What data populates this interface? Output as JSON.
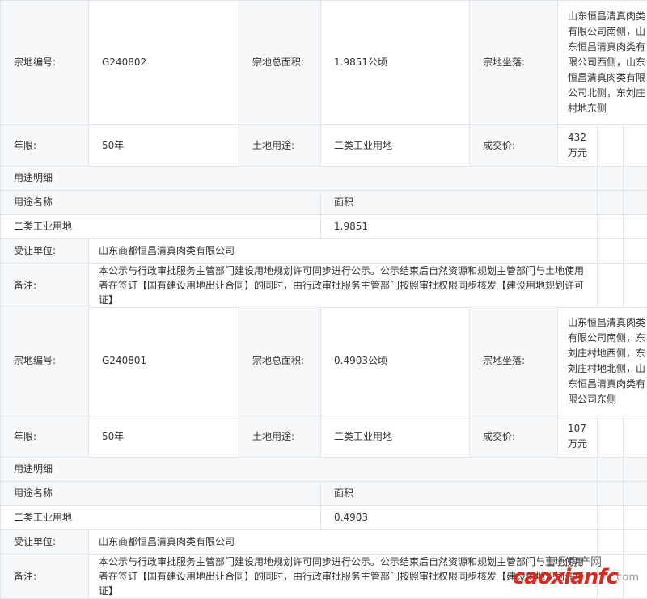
{
  "parcels": [
    {
      "parcel_no_label": "宗地编号:",
      "parcel_no": "G240802",
      "area_label": "宗地总面积:",
      "area": "1.9851公顷",
      "location_label": "宗地坐落:",
      "location": "山东恒昌清真肉类有限公司南侧，山东恒昌清真肉类有限公司西侧，山东恒昌清真肉类有限公司北侧，东刘庄村地东侧",
      "term_label": "年限:",
      "term": "50年",
      "usage_label": "土地用途:",
      "usage": "二类工业用地",
      "price_label": "成交价:",
      "price": "432万元",
      "detail_title": "用途明细",
      "detail_name_header": "用途名称",
      "detail_area_header": "面积",
      "detail_name": "二类工业用地",
      "detail_area": "1.9851",
      "grantee_label": "受让单位:",
      "grantee": "山东商都恒昌清真肉类有限公司",
      "remark_label": "备注:",
      "remark": "本公示与行政审批服务主管部门建设用地规划许可同步进行公示。公示结束后自然资源和规划主管部门与土地使用者在签订【国有建设用地出让合同】的同时，由行政审批服务主管部门按照审批权限同步核发【建设用地规划许可证】"
    },
    {
      "parcel_no_label": "宗地编号:",
      "parcel_no": "G240801",
      "area_label": "宗地总面积:",
      "area": "0.4903公顷",
      "location_label": "宗地坐落:",
      "location": "山东恒昌清真肉类有限公司南侧，东刘庄村地西侧，东刘庄村地北侧，山东恒昌清真肉类有限公司东侧",
      "term_label": "年限:",
      "term": "50年",
      "usage_label": "土地用途:",
      "usage": "二类工业用地",
      "price_label": "成交价:",
      "price": "107万元",
      "detail_title": "用途明细",
      "detail_name_header": "用途名称",
      "detail_area_header": "面积",
      "detail_name": "二类工业用地",
      "detail_area": "0.4903",
      "grantee_label": "受让单位:",
      "grantee": "山东商都恒昌清真肉类有限公司",
      "remark_label": "备注:",
      "remark": "本公示与行政审批服务主管部门建设用地规划许可同步进行公示。公示结束后自然资源和规划主管部门与土地使用者在签订【国有建设用地出让合同】的同时，由行政审批服务主管部门按照审批权限同步核发【建设用地规划许可证】"
    }
  ],
  "watermark": {
    "site_name": "曹县房产网",
    "domain": "caoxianfc",
    "suffix": ".com"
  }
}
